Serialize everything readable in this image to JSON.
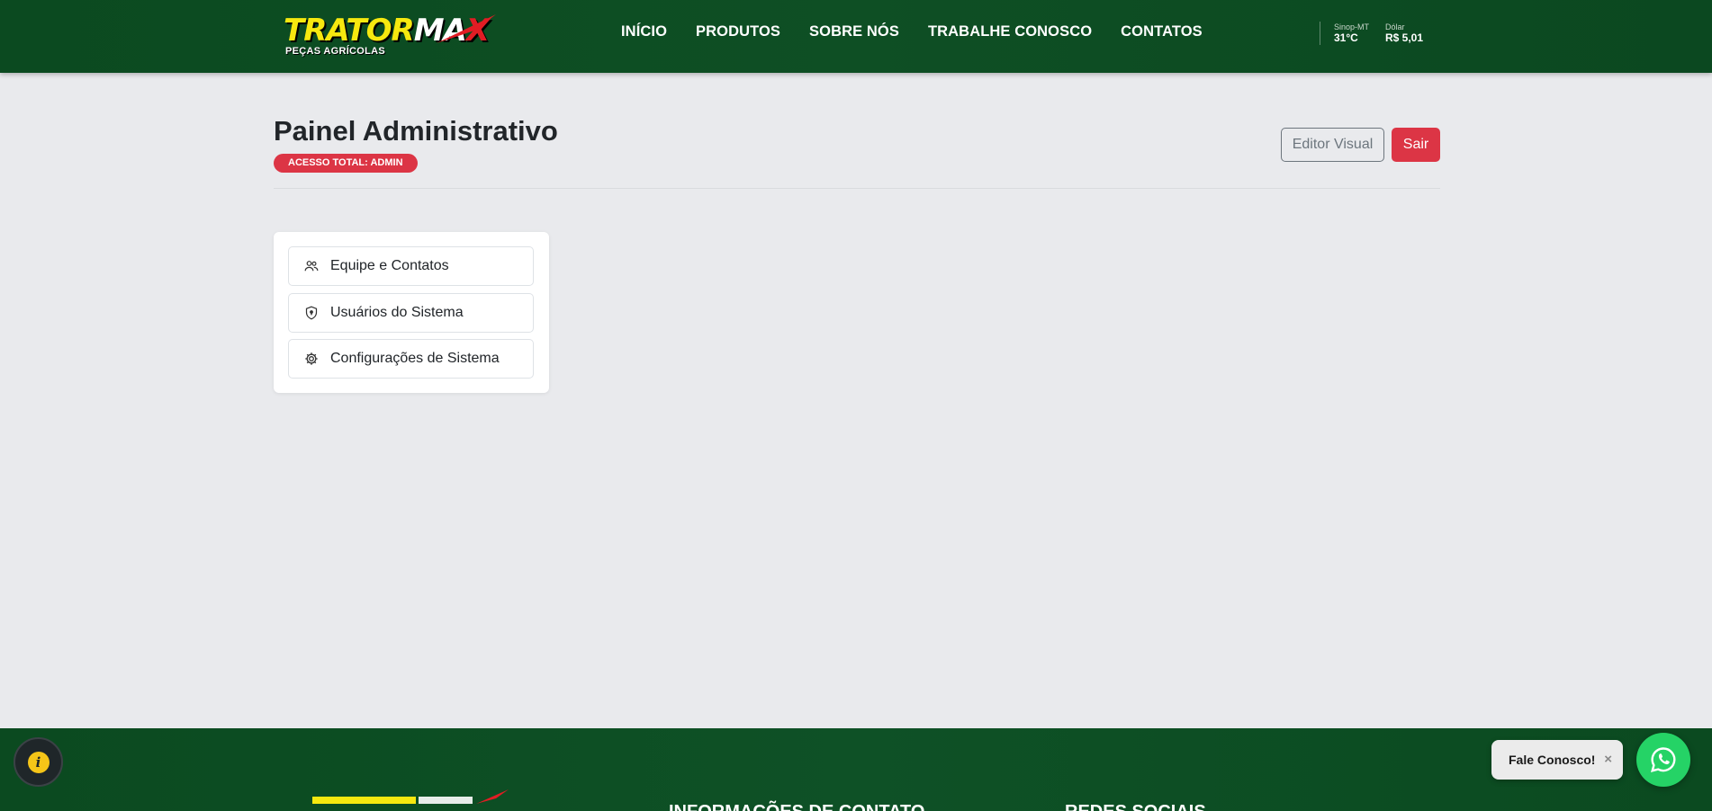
{
  "brand": {
    "logo_text_1": "TRATOR",
    "logo_text_2": "MA",
    "logo_text_3": "X",
    "logo_subtitle": "PEÇAS AGRÍCOLAS",
    "colors": {
      "primary": "#0b4a20",
      "accent_yellow": "#f6e80f",
      "accent_red": "#e11d24"
    }
  },
  "nav": {
    "items": [
      {
        "label": "INÍCIO"
      },
      {
        "label": "PRODUTOS"
      },
      {
        "label": "SOBRE NÓS"
      },
      {
        "label": "TRABALHE CONOSCO"
      },
      {
        "label": "CONTATOS"
      }
    ]
  },
  "header_info": {
    "weather": {
      "city": "Sinop-MT",
      "temperature": "31°C"
    },
    "currency": {
      "label": "Dólar",
      "value": "R$ 5,01"
    }
  },
  "page": {
    "title": "Painel Administrativo",
    "badge": "ACESSO TOTAL: ADMIN",
    "buttons": {
      "editor": "Editor Visual",
      "logout": "Sair"
    },
    "menu": [
      {
        "label": "Equipe e Contatos",
        "icon": "people-icon"
      },
      {
        "label": "Usuários do Sistema",
        "icon": "shield-icon"
      },
      {
        "label": "Configurações de Sistema",
        "icon": "gear-icon"
      }
    ]
  },
  "footer": {
    "headings": [
      "INFORMAÇÕES DE CONTATO",
      "REDES SOCIAIS"
    ]
  },
  "floating": {
    "chat_label": "Fale Conosco!",
    "chat_close": "×",
    "info_icon_glyph": "i",
    "whatsapp_color": "#25d366"
  },
  "status_colors": {
    "danger": "#dc3545",
    "secondary": "#6c757d"
  }
}
